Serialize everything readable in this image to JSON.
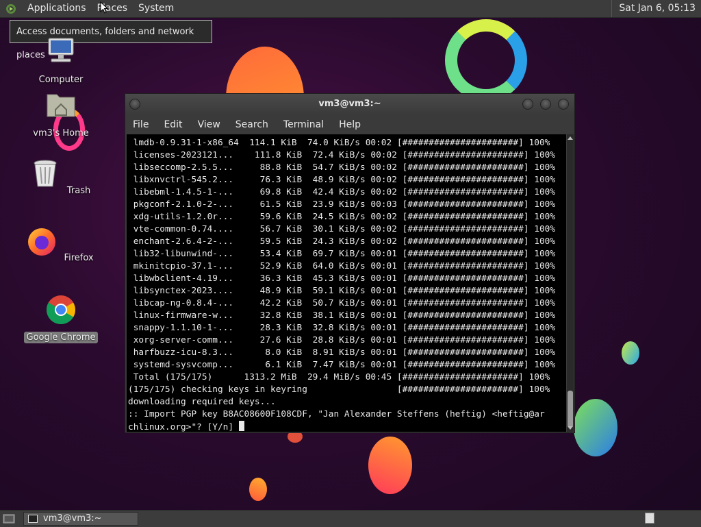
{
  "top_panel": {
    "menus": [
      "Applications",
      "Places",
      "System"
    ],
    "clock": "Sat Jan  6, 05:13"
  },
  "tooltip": "Access documents, folders and network places",
  "desktop_icons": [
    {
      "label": "Computer",
      "icon": "computer-icon"
    },
    {
      "label": "vm3's Home",
      "icon": "home-folder-icon"
    },
    {
      "label": "Trash",
      "icon": "trash-icon"
    },
    {
      "label": "Firefox",
      "icon": "firefox-icon"
    },
    {
      "label": "Google Chrome",
      "icon": "chrome-icon"
    }
  ],
  "terminal": {
    "title": "vm3@vm3:~",
    "menu": [
      "File",
      "Edit",
      "View",
      "Search",
      "Terminal",
      "Help"
    ],
    "lines": [
      " lmdb-0.9.31-1-x86_64  114.1 KiB  74.0 KiB/s 00:02 [######################] 100%",
      " licenses-2023121...    111.8 KiB  72.4 KiB/s 00:02 [######################] 100%",
      " libseccomp-2.5.5...     88.8 KiB  54.7 KiB/s 00:02 [######################] 100%",
      " libxnvctrl-545.2...     76.3 KiB  48.9 KiB/s 00:02 [######################] 100%",
      " libebml-1.4.5-1-...     69.8 KiB  42.4 KiB/s 00:02 [######################] 100%",
      " pkgconf-2.1.0-2-...     61.5 KiB  23.9 KiB/s 00:03 [######################] 100%",
      " xdg-utils-1.2.0r...     59.6 KiB  24.5 KiB/s 00:02 [######################] 100%",
      " vte-common-0.74....     56.7 KiB  30.1 KiB/s 00:02 [######################] 100%",
      " enchant-2.6.4-2-...     59.5 KiB  24.3 KiB/s 00:02 [######################] 100%",
      " lib32-libunwind-...     53.4 KiB  69.7 KiB/s 00:01 [######################] 100%",
      " mkinitcpio-37.1-...     52.9 KiB  64.0 KiB/s 00:01 [######################] 100%",
      " libwbclient-4.19...     36.3 KiB  45.3 KiB/s 00:01 [######################] 100%",
      " libsynctex-2023....     48.9 KiB  59.1 KiB/s 00:01 [######################] 100%",
      " libcap-ng-0.8.4-...     42.2 KiB  50.7 KiB/s 00:01 [######################] 100%",
      " linux-firmware-w...     32.8 KiB  38.1 KiB/s 00:01 [######################] 100%",
      " snappy-1.1.10-1-...     28.3 KiB  32.8 KiB/s 00:01 [######################] 100%",
      " xorg-server-comm...     27.6 KiB  28.8 KiB/s 00:01 [######################] 100%",
      " harfbuzz-icu-8.3...      8.0 KiB  8.91 KiB/s 00:01 [######################] 100%",
      " systemd-sysvcomp...      6.1 KiB  7.47 KiB/s 00:01 [######################] 100%",
      " Total (175/175)      1313.2 MiB  29.4 MiB/s 00:45 [######################] 100%",
      "(175/175) checking keys in keyring                 [######################] 100%",
      "downloading required keys...",
      ":: Import PGP key B8AC08600F108CDF, \"Jan Alexander Steffens (heftig) <heftig@ar",
      "chlinux.org>\"? [Y/n] "
    ]
  },
  "taskbar": {
    "task_label": "vm3@vm3:~"
  }
}
